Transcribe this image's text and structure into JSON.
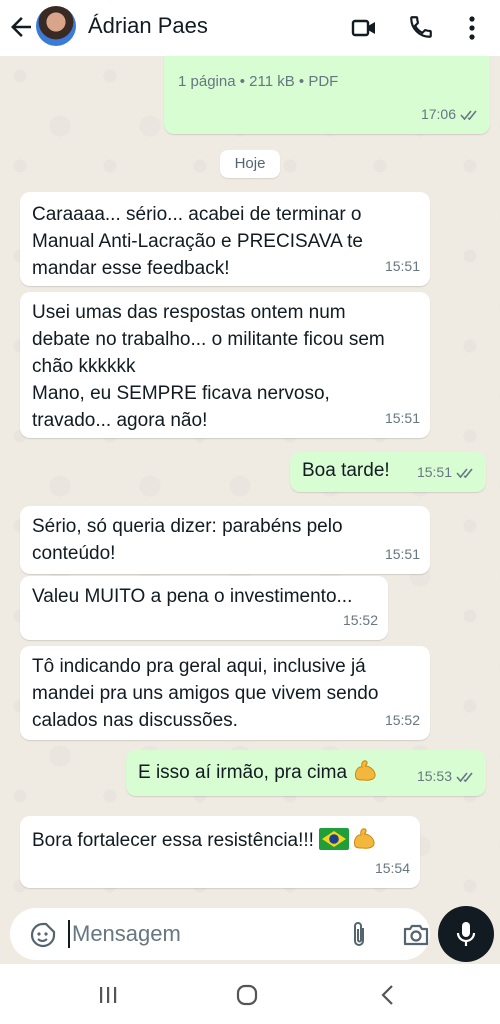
{
  "header": {
    "contact_name": "Ádrian Paes",
    "icons": [
      "back-arrow-icon",
      "video-call-icon",
      "phone-icon",
      "more-vert-icon"
    ]
  },
  "chat": {
    "pdf_message": {
      "meta": "1 página • 211 kB • PDF",
      "time": "17:06"
    },
    "day_chip": "Hoje",
    "messages": [
      {
        "direction": "in",
        "text": "Caraaaa... sério... acabei de terminar o\nManual Anti-Lacração e PRECISAVA te\nmandar esse feedback!",
        "time": "15:51"
      },
      {
        "direction": "in",
        "text": "Usei umas das respostas ontem num\ndebate no trabalho... o militante ficou sem\nchão kkkkkk\nMano, eu SEMPRE ficava nervoso,\ntravado... agora não!",
        "time": "15:51"
      },
      {
        "direction": "out",
        "text": "Boa tarde!",
        "time": "15:51"
      },
      {
        "direction": "in",
        "text": "Sério, só queria dizer: parabéns pelo\nconteúdo!",
        "time": "15:51"
      },
      {
        "direction": "in",
        "text": "Valeu MUITO a pena o investimento...",
        "time": "15:52"
      },
      {
        "direction": "in",
        "text": "Tô indicando pra geral aqui, inclusive já\nmandei pra uns amigos que vivem sendo\ncalados nas discussões.",
        "time": "15:52"
      },
      {
        "direction": "out",
        "text": "E isso aí irmão, pra cima",
        "time": "15:53"
      },
      {
        "direction": "in",
        "text": "Bora fortalecer essa resistência!!!",
        "time": "15:54"
      }
    ]
  },
  "input": {
    "placeholder": "Mensagem"
  },
  "colors": {
    "incoming": "#ffffff",
    "outgoing": "#d9fdd3",
    "chat_bg": "#efeae2",
    "read_ticks": "#53bdeb"
  }
}
